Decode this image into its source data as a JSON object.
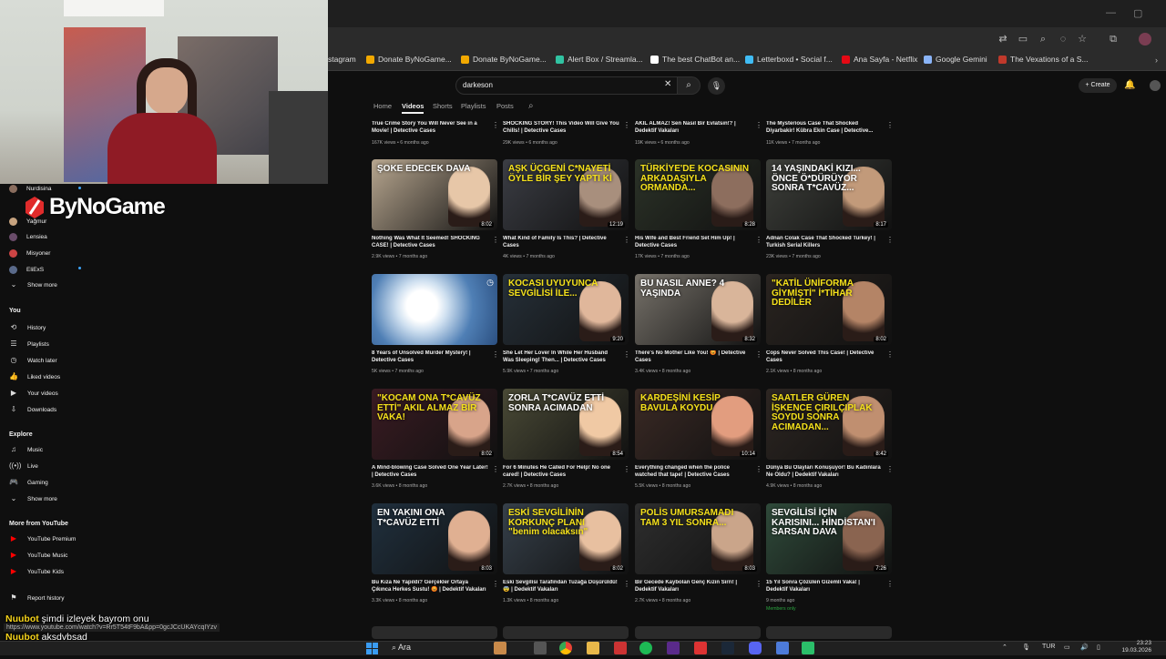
{
  "bookmarks": [
    {
      "label": "stagram",
      "color": ""
    },
    {
      "label": "Donate ByNoGame...",
      "color": "#f2a900"
    },
    {
      "label": "Donate ByNoGame...",
      "color": "#f2a900"
    },
    {
      "label": "Alert Box / Streamla...",
      "color": "#31c3a2"
    },
    {
      "label": "The best ChatBot an...",
      "color": "#ffffff"
    },
    {
      "label": "Letterboxd • Social f...",
      "color": "#40bcf4"
    },
    {
      "label": "Ana Sayfa - Netflix",
      "color": "#e50914"
    },
    {
      "label": "Google Gemini",
      "color": "#8ab4f8"
    },
    {
      "label": "The Vexations of a S...",
      "color": "#c0392b"
    }
  ],
  "search": {
    "query": "darkeson"
  },
  "header": {
    "create_label": "Create"
  },
  "channel_tabs": [
    "Home",
    "Videos",
    "Shorts",
    "Playlists",
    "Posts"
  ],
  "streamer_logo": "ByNoGame",
  "sidebar": {
    "subs": [
      "Nurdisina",
      "Yağmur",
      "Lensiea",
      "Misyoner",
      "EliExS"
    ],
    "show_more": "Show more",
    "you_heading": "You",
    "you_items": [
      "History",
      "Playlists",
      "Watch later",
      "Liked videos",
      "Your videos",
      "Downloads"
    ],
    "explore_heading": "Explore",
    "explore_items": [
      "Music",
      "Live",
      "Gaming"
    ],
    "show_more_2": "Show more",
    "more_heading": "More from YouTube",
    "more_items": [
      "YouTube Premium",
      "YouTube Music",
      "YouTube Kids"
    ],
    "report": "Report history"
  },
  "videos_top_row": [
    {
      "title": "True Crime Story You Will Never See in a Movie! | Detective Cases",
      "meta": "167K views • 6 months ago"
    },
    {
      "title": "SHOCKING STORY! This Video Will Give You Chills! | Detective Cases",
      "meta": "29K views • 6 months ago"
    },
    {
      "title": "AKIL ALMAZ! Sen Nasıl Bir Evlatsın!? | Dedektif Vakaları",
      "meta": "19K views • 6 months ago"
    },
    {
      "title": "The Mysterious Case That Shocked Diyarbakir! Kübra Ekin Case | Detective...",
      "meta": "11K views • 7 months ago"
    }
  ],
  "videos": [
    {
      "thumb": "ŞOKE EDECEK DAVA",
      "dur": "8:02",
      "title": "Nothing Was What It Seemed! SHOCKING CASE! | Detective Cases",
      "meta": "2.9K views • 7 months ago",
      "bg": "#b7a68f",
      "face": "#e7c7a8"
    },
    {
      "thumb": "AŞK ÜÇGENİ C*NAYETİ ÖYLE BİR ŞEY YAPTI Kİ",
      "dur": "12:19",
      "title": "What Kind of Family Is This? | Detective Cases",
      "meta": "4K views • 7 months ago",
      "bg": "#3b3d44",
      "face": "#a88f7d"
    },
    {
      "thumb": "TÜRKİYE'DE KOCASININ ARKADAŞIYLA ORMANDA...",
      "dur": "8:28",
      "title": "His Wife and Best Friend Set Him Up! | Detective Cases",
      "meta": "17K views • 7 months ago",
      "bg": "#2c3328",
      "face": "#8d6e5e"
    },
    {
      "thumb": "14 YAŞINDAKİ KIZI... ÖNCE Ö*DÜRÜYOR SONRA T*CAVÜZ...",
      "dur": "8:17",
      "title": "Adnan Colak Case That Shocked Turkey! | Turkish Serial Killers",
      "meta": "23K views • 7 months ago",
      "bg": "#3d3f3a",
      "face": "#c29a7a"
    },
    {
      "thumb": "",
      "dur": "",
      "title": "8 Years of Unsolved Murder Mystery! | Detective Cases",
      "meta": "5K views • 7 months ago",
      "bg": "#5b86b8",
      "face": ""
    },
    {
      "thumb": "KOCASI UYUYUNCA SEVGİLİSİ İLE...",
      "dur": "9:20",
      "title": "She Let Her Lover In While Her Husband Was Sleeping! Then... | Detective Cases",
      "meta": "5.9K views • 7 months ago",
      "bg": "#263039",
      "face": "#e0b79b"
    },
    {
      "thumb": "BU NASIL ANNE? 4 YAŞINDA",
      "dur": "8:32",
      "title": "There's No Mother Like You! 😡 | Detective Cases",
      "meta": "3.4K views • 8 months ago",
      "bg": "#77726a",
      "face": "#d9b59a"
    },
    {
      "thumb": "\"KATİL ÜNİFORMA GİYMİŞTİ\" İ*TİHAR DEDİLER",
      "dur": "8:02",
      "title": "Cops Never Solved This Case! | Detective Cases",
      "meta": "2.1K views • 8 months ago",
      "bg": "#2a2420",
      "face": "#b48466"
    },
    {
      "thumb": "\"KOCAM ONA T*CAVÜZ ETTİ\" AKIL ALMAZ BİR VAKA!",
      "dur": "8:02",
      "title": "A Mind-blowing Case Solved One Year Later! | Detective Cases",
      "meta": "3.6K views • 8 months ago",
      "bg": "#3a1b22",
      "face": "#d8a48a"
    },
    {
      "thumb": "ZORLA T*CAVÜZ ETTİ SONRA ACIMADAN",
      "dur": "8:54",
      "title": "For 6 Minutes He Called For Help! No one cared! | Detective Cases",
      "meta": "2.7K views • 8 months ago",
      "bg": "#4a4a36",
      "face": "#f0c9a4"
    },
    {
      "thumb": "KARDEŞİNİ KESİP BAVULA KOYDU",
      "dur": "10:14",
      "title": "Everything changed when the police watched that tape! | Detective Cases",
      "meta": "5.5K views • 8 months ago",
      "bg": "#3b2a25",
      "face": "#e29d7f"
    },
    {
      "thumb": "SAATLER GÜREN İŞKENCE ÇIRILÇIPLAK SOYDU SONRA ACIMADAN...",
      "dur": "8:42",
      "title": "Dünya Bu Olayları Konuşuyor! Bu Kadınlara Ne Oldu? | Dedektif Vakaları",
      "meta": "4.9K views • 8 months ago",
      "bg": "#2d2622",
      "face": "#c08f70"
    },
    {
      "thumb": "EN YAKINI ONA T*CAVÜZ ETTİ",
      "dur": "8:03",
      "title": "Bu Kıza Ne Yapıldı? Gerçekler Ortaya Çıkınca Herkes Sustu! 😡 | Dedektif Vakaları",
      "meta": "3.3K views • 8 months ago",
      "bg": "#20303e",
      "face": "#e0b092"
    },
    {
      "thumb": "ESKİ SEVGİLİNİN KORKUNÇ PLANI \"benim olacaksın\"",
      "dur": "8:02",
      "title": "Eski Sevgilisi Tarafından Tuzağa Düşürüldü! 😨 | Dedektif Vakaları",
      "meta": "1.3K views • 8 months ago",
      "bg": "#36404a",
      "face": "#e8c0a0"
    },
    {
      "thumb": "POLİS UMURSAMADI TAM 3 YIL SONRA...",
      "dur": "8:03",
      "title": "Bir Gecede Kaybolan Genç Kızın Sırrı! | Dedektif Vakaları",
      "meta": "2.7K views • 8 months ago",
      "bg": "#2e2e2e",
      "face": "#caa58a"
    },
    {
      "thumb": "SEVGİLİSİ İÇİN KARISINI... HİNDİSTAN'I SARSAN DAVA",
      "dur": "7:26",
      "title": "15 Yıl Sonra Çözülen Gizemli Vaka! | Dedektif Vakaları",
      "meta": "9 months ago",
      "bg": "#2f4a3a",
      "face": "#8a6450",
      "members": "Members only"
    }
  ],
  "chat": [
    {
      "user": "Nuubot",
      "text": "şimdi izleyek bayrom onu"
    },
    {
      "user": "Nuubot",
      "text": "aksdvbsad"
    }
  ],
  "status_url": "https://www.youtube.com/watch?v=Rr5T54tF9bA&pp=0gcJCcUKAYcqIYzv",
  "taskbar": {
    "search": "Ara",
    "lang": "TUR",
    "time": "23:23",
    "date": "19.03.2026"
  }
}
